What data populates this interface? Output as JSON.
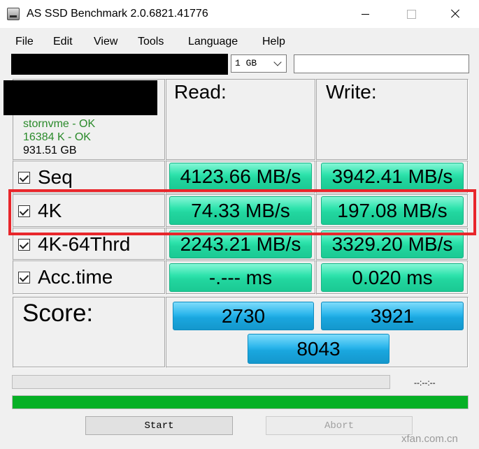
{
  "window": {
    "title": "AS SSD Benchmark 2.0.6821.41776",
    "icons": {
      "app": "drive-icon",
      "minimize": "minimize-icon",
      "maximize": "maximize-icon",
      "close": "close-icon"
    }
  },
  "menu": [
    "File",
    "Edit",
    "View",
    "Tools",
    "Language",
    "Help"
  ],
  "toolbar": {
    "size_select": {
      "selected": "1 GB",
      "icon": "chevron-down-icon"
    },
    "text_field": ""
  },
  "drive_info": {
    "driver": "stornvme - OK",
    "alignment": "16384 K - OK",
    "capacity": "931.51 GB"
  },
  "columns": {
    "read": "Read:",
    "write": "Write:"
  },
  "tests": [
    {
      "label": "Seq",
      "checked": true,
      "read": "4123.66 MB/s",
      "write": "3942.41 MB/s"
    },
    {
      "label": "4K",
      "checked": true,
      "read": "74.33 MB/s",
      "write": "197.08 MB/s"
    },
    {
      "label": "4K-64Thrd",
      "checked": true,
      "read": "2243.21 MB/s",
      "write": "3329.20 MB/s"
    },
    {
      "label": "Acc.time",
      "checked": true,
      "read": "-.--- ms",
      "write": "0.020 ms"
    }
  ],
  "score": {
    "label": "Score:",
    "read": "2730",
    "write": "3921",
    "total": "8043"
  },
  "status": {
    "time": "--:--:--",
    "test_progress": 0,
    "overall_progress": 1
  },
  "buttons": {
    "start": "Start",
    "abort": "Abort"
  },
  "watermark": "xfan.com.cn",
  "colors": {
    "result_green": "#2ee3ac",
    "score_blue": "#2cb6ec",
    "ok_text": "#2a8a2a",
    "highlight_red": "#e8262b",
    "progress_green": "#06b025"
  }
}
